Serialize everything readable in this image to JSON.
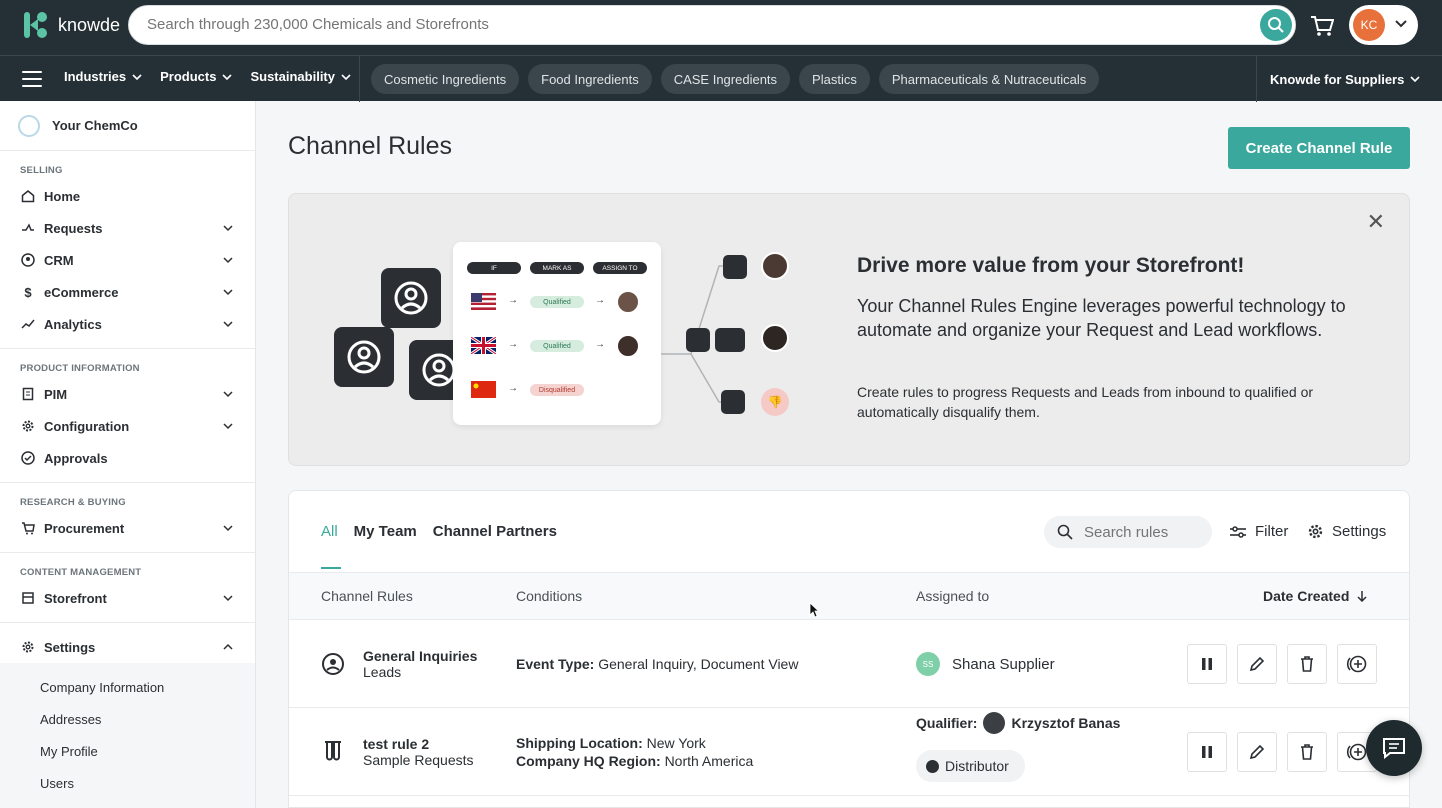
{
  "topbar": {
    "logo_text": "knowde",
    "search_placeholder": "Search through 230,000 Chemicals and Storefronts",
    "avatar_initials": "KC"
  },
  "nav": {
    "menu": [
      {
        "label": "Industries"
      },
      {
        "label": "Products"
      },
      {
        "label": "Sustainability"
      }
    ],
    "chips": [
      {
        "label": "Cosmetic Ingredients"
      },
      {
        "label": "Food Ingredients"
      },
      {
        "label": "CASE Ingredients"
      },
      {
        "label": "Plastics"
      },
      {
        "label": "Pharmaceuticals & Nutraceuticals"
      }
    ],
    "suppliers_label": "Knowde for Suppliers"
  },
  "sidebar": {
    "company": "Your ChemCo",
    "sections": [
      {
        "label": "SELLING",
        "items": [
          "Home",
          "Requests",
          "CRM",
          "eCommerce",
          "Analytics"
        ]
      },
      {
        "label": "PRODUCT INFORMATION",
        "items": [
          "PIM",
          "Configuration",
          "Approvals"
        ]
      },
      {
        "label": "RESEARCH & BUYING",
        "items": [
          "Procurement"
        ]
      },
      {
        "label": "CONTENT MANAGEMENT",
        "items": [
          "Storefront"
        ]
      }
    ],
    "settings_label": "Settings",
    "settings_sub": [
      "Company Information",
      "Addresses",
      "My Profile",
      "Users"
    ]
  },
  "main": {
    "title": "Channel Rules",
    "create_button": "Create Channel Rule"
  },
  "banner": {
    "heading": "Drive more value from your Storefront!",
    "text": "Your Channel Rules Engine leverages powerful technology to automate and organize your Request and Lead workflows.",
    "sub": "Create rules to progress Requests and Leads from inbound to qualified or automatically disqualify them.",
    "illustration": {
      "tag_if": "IF",
      "tag_mark": "MARK AS",
      "tag_assign": "ASSIGN TO",
      "qualified": "Qualified",
      "disqualified": "Disqualified"
    }
  },
  "rules": {
    "tabs": [
      "All",
      "My Team",
      "Channel Partners"
    ],
    "search_placeholder": "Search rules",
    "filter_label": "Filter",
    "settings_label": "Settings",
    "columns": {
      "rule": "Channel Rules",
      "conditions": "Conditions",
      "assigned": "Assigned to",
      "date": "Date Created"
    },
    "rows": [
      {
        "name": "General Inquiries",
        "type": "Leads",
        "conditions": [
          {
            "key": "Event Type:",
            "value": "General Inquiry, Document View"
          }
        ],
        "assignee_initials": "SS",
        "assignee": "Shana Supplier"
      },
      {
        "name": "test rule 2",
        "type": "Sample Requests",
        "conditions": [
          {
            "key": "Shipping Location:",
            "value": "New York"
          },
          {
            "key": "Company HQ Region:",
            "value": "North America"
          }
        ],
        "qualifier_label": "Qualifier:",
        "qualifier": "Krzysztof Banas",
        "badge": "Distributor"
      }
    ]
  },
  "colors": {
    "accent": "#3aa89c",
    "topbar": "#253036"
  }
}
